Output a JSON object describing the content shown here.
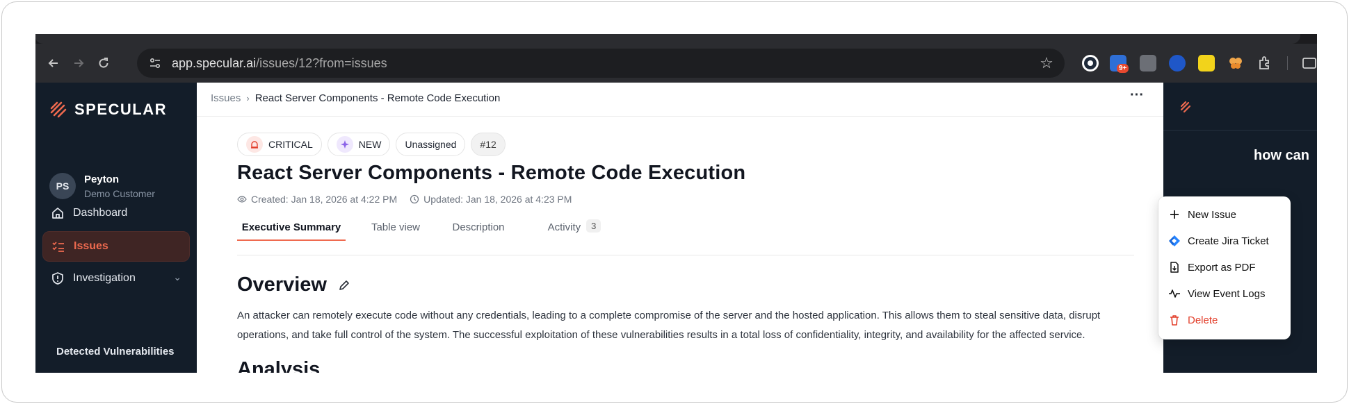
{
  "browser": {
    "url_host": "app.specular.ai",
    "url_path": "/issues/12?from=issues",
    "notification_badge": "9+"
  },
  "sidebar": {
    "logo_text": "SPECULAR",
    "user": {
      "initials": "PS",
      "name": "Peyton",
      "role": "Demo Customer"
    },
    "items": [
      {
        "label": "Dashboard"
      },
      {
        "label": "Issues"
      },
      {
        "label": "Investigation"
      }
    ],
    "sub_item": "Detected Vulnerabilities"
  },
  "main": {
    "breadcrumb": {
      "root": "Issues",
      "current": "React Server Components - Remote Code Execution"
    },
    "badges": {
      "severity": "CRITICAL",
      "status": "NEW",
      "assignee": "Unassigned",
      "number": "#12"
    },
    "title": "React Server Components - Remote Code Execution",
    "created": "Created: Jan 18, 2026 at 4:22 PM",
    "updated": "Updated: Jan 18, 2026 at 4:23 PM",
    "tabs": [
      {
        "label": "Executive Summary"
      },
      {
        "label": "Table view"
      },
      {
        "label": "Description"
      },
      {
        "label": "Activity",
        "count": "3"
      }
    ],
    "overview_heading": "Overview",
    "overview_text": "An attacker can remotely execute code without any credentials, leading to a complete compromise of the server and the hosted application. This allows them to steal sensitive data, disrupt operations, and take full control of the system. The successful exploitation of these vulnerabilities results in a total loss of confidentiality, integrity, and availability for the affected service.",
    "analysis_heading": "Analysis"
  },
  "menu": {
    "items": [
      {
        "label": "New Issue"
      },
      {
        "label": "Create Jira Ticket"
      },
      {
        "label": "Export as PDF"
      },
      {
        "label": "View Event Logs"
      },
      {
        "label": "Delete"
      }
    ]
  },
  "right_panel": {
    "peek_text": "how can"
  },
  "colors": {
    "accent": "#ef6a4f",
    "sidebar_bg": "#131d29",
    "danger": "#e23e2a"
  }
}
